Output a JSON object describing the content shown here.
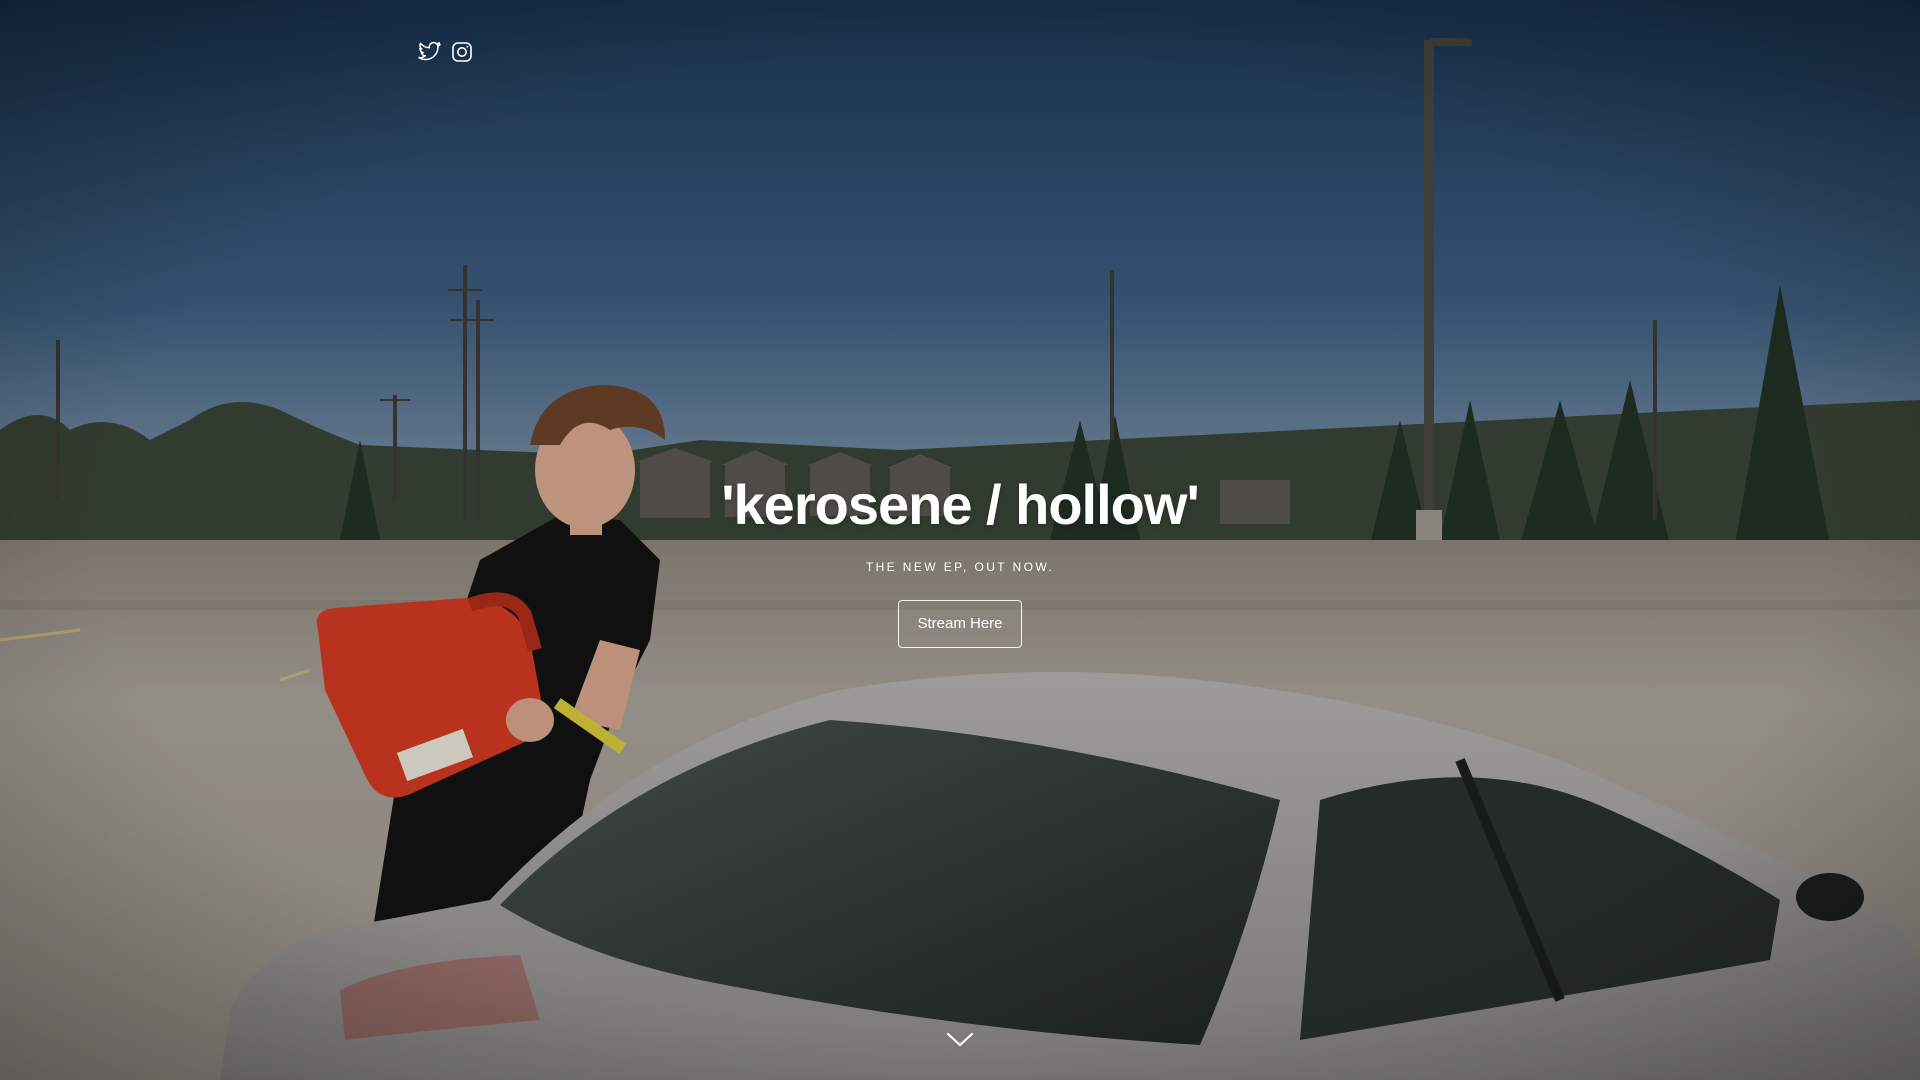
{
  "header": {
    "social_links": [
      {
        "name": "twitter",
        "icon": "twitter-icon"
      },
      {
        "name": "instagram",
        "icon": "instagram-icon"
      }
    ]
  },
  "hero": {
    "title": "'kerosene / hollow'",
    "subtitle": "THE NEW EP, OUT NOW.",
    "cta_label": "Stream Here",
    "scroll_icon": "chevron-down-icon"
  },
  "colors": {
    "sky_top": "#1d3a5c",
    "sky_bottom": "#7d93a8",
    "text": "#ffffff",
    "gas_can": "#d8361f",
    "car": "#a9a7a6",
    "pavement": "#a49f98"
  }
}
